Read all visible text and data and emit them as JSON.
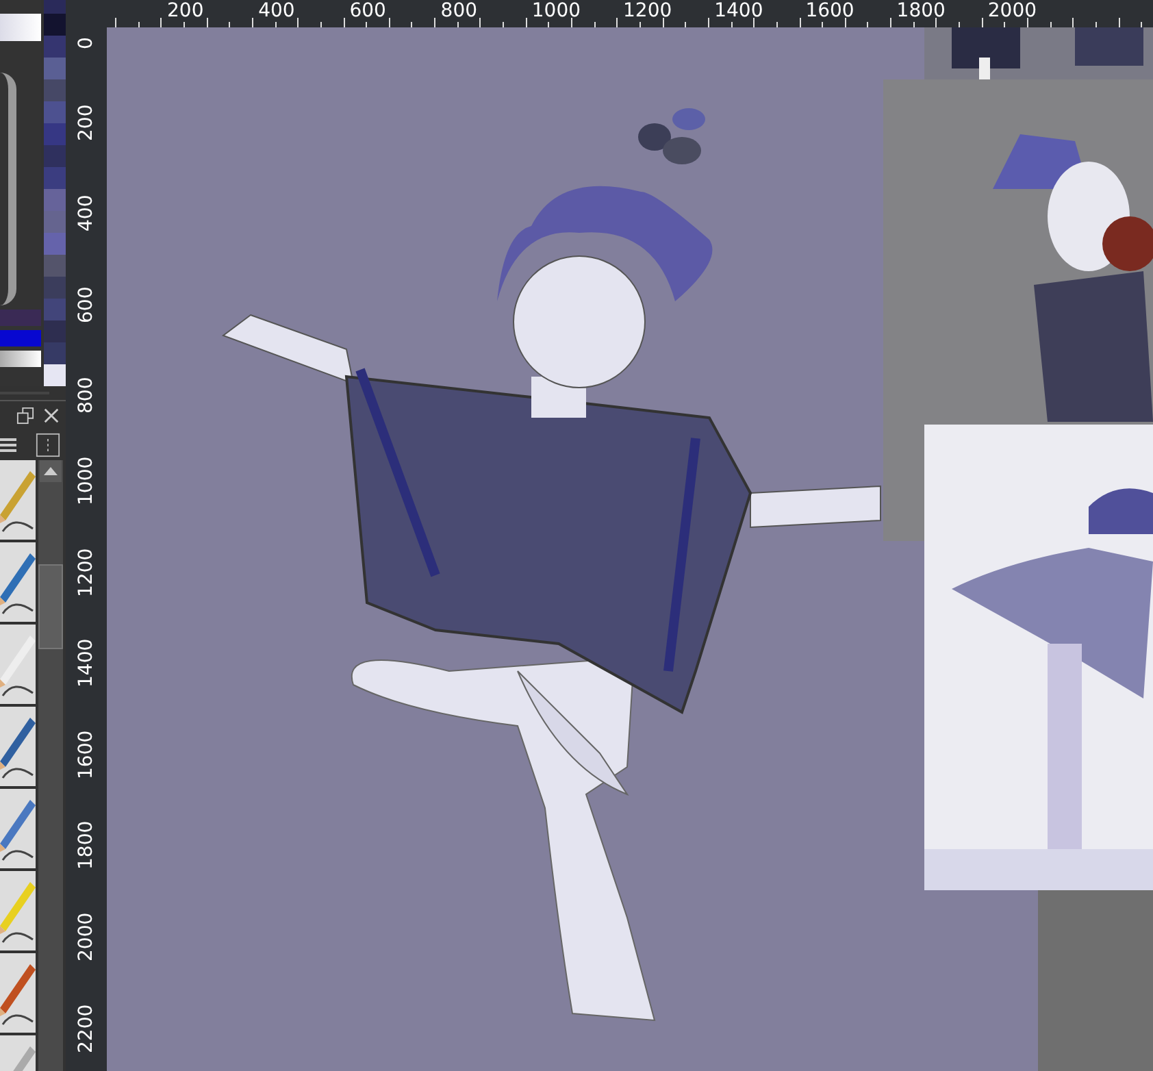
{
  "palette": [
    {
      "color": "#2a2a5a"
    },
    {
      "color": "#13132f"
    },
    {
      "color": "#353570"
    },
    {
      "color": "#5a5f94"
    },
    {
      "color": "#464866"
    },
    {
      "color": "#4d5190"
    },
    {
      "color": "#363784"
    },
    {
      "color": "#2f305e"
    },
    {
      "color": "#3b3d80"
    },
    {
      "color": "#66639a"
    },
    {
      "color": "#65648f"
    },
    {
      "color": "#6563ab"
    },
    {
      "color": "#54546b"
    },
    {
      "color": "#3b3d5c"
    },
    {
      "color": "#42457a"
    },
    {
      "color": "#2e2e50"
    },
    {
      "color": "#363a65"
    },
    {
      "color": "#e6e6f3"
    }
  ],
  "horizontal_ruler": {
    "labels": [
      "200",
      "400",
      "600",
      "800",
      "1000",
      "1200",
      "1400",
      "1600",
      "1800",
      "2000"
    ]
  },
  "vertical_ruler": {
    "labels": [
      "0",
      "200",
      "400",
      "600",
      "800",
      "1000",
      "1200",
      "1400",
      "1600",
      "1800",
      "2000",
      "2200"
    ]
  }
}
